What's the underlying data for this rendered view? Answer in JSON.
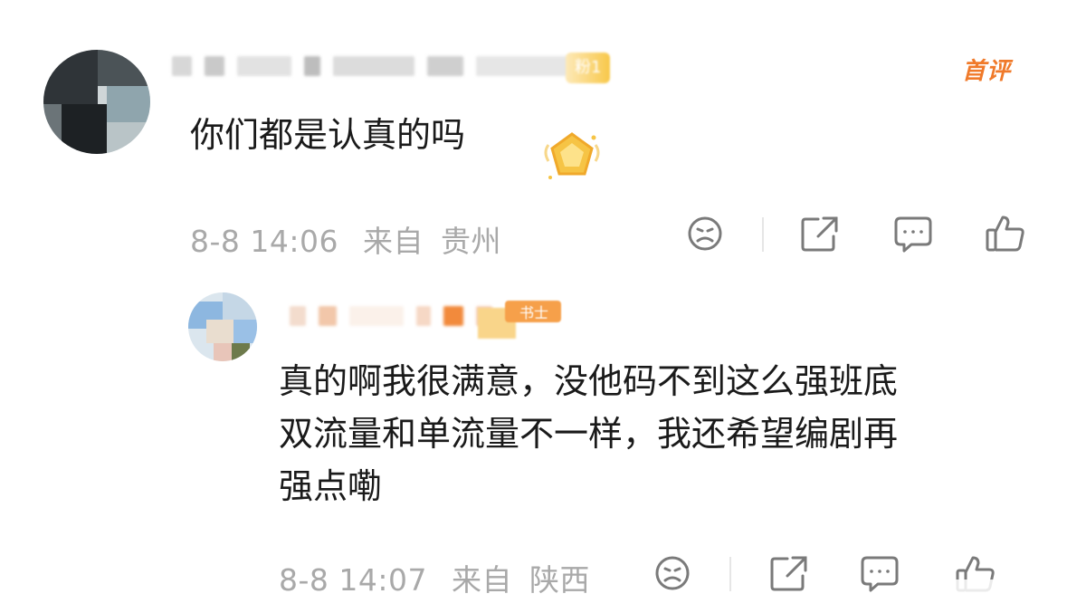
{
  "comments": [
    {
      "badge_text": "粉1",
      "first_tag": "首评",
      "text": "你们都是认真的吗",
      "time": "8-8 14:06",
      "from_label": "来自",
      "location": "贵州"
    },
    {
      "badge_text": "书士",
      "text_lines": [
        "真的啊我很满意，没他码不到这么强班底",
        "双流量和单流量不一样，我还希望编剧再",
        "强点嘞"
      ],
      "time": "8-8 14:07",
      "from_label": "来自",
      "location": "陕西"
    }
  ],
  "icons": [
    "dislike-face-icon",
    "share-icon",
    "comment-icon",
    "like-icon"
  ]
}
